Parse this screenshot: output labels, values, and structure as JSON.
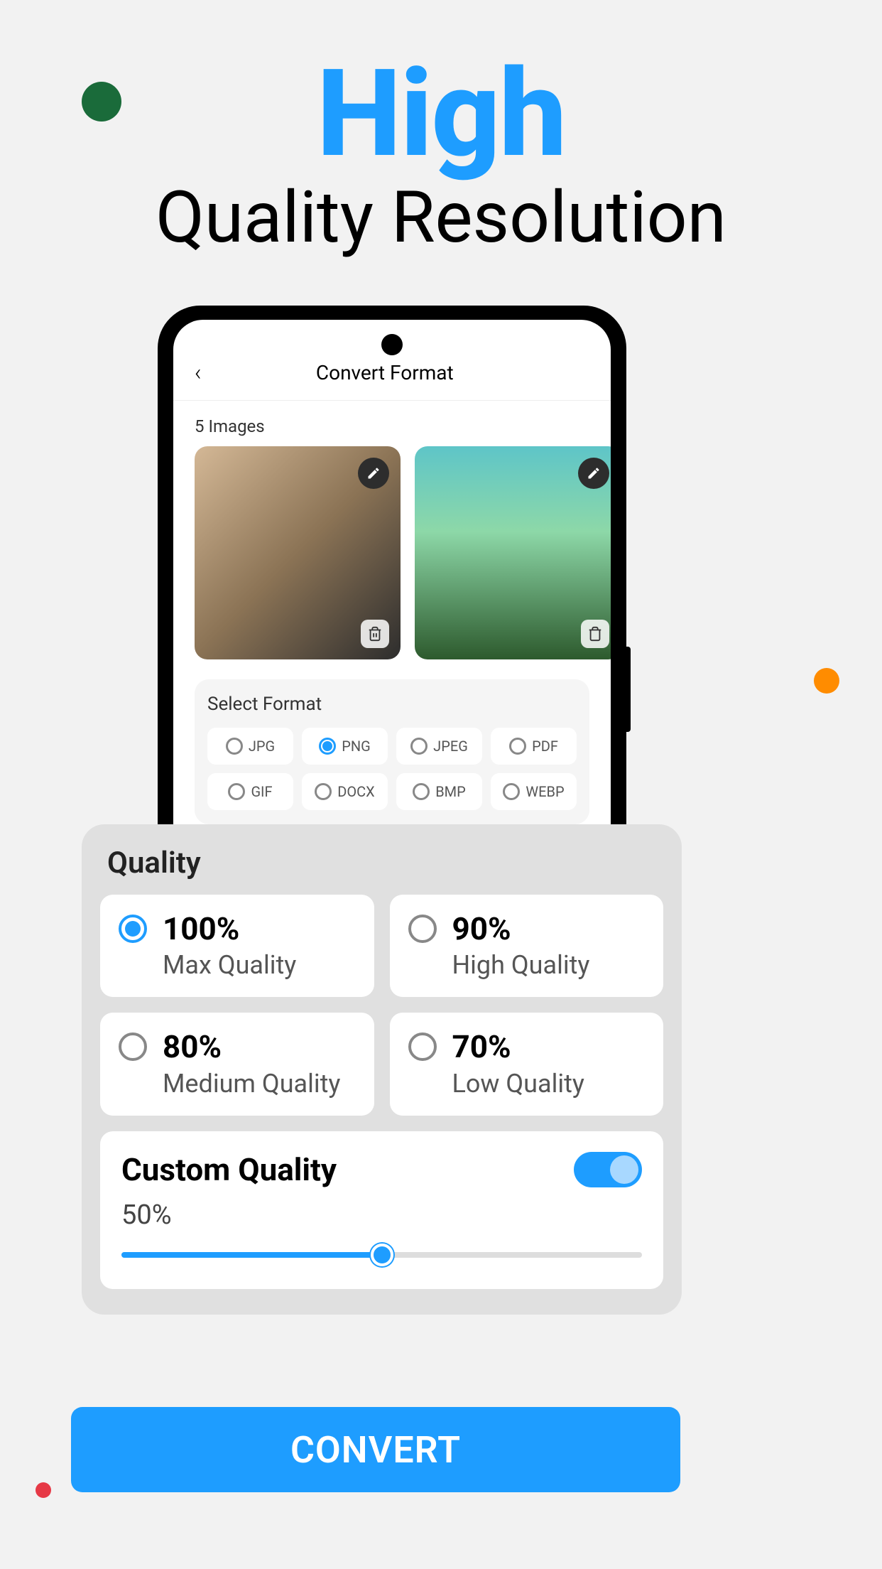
{
  "hero": {
    "high": "High",
    "sub": "Quality Resolution"
  },
  "phone": {
    "title": "Convert Format",
    "images_count": "5 Images",
    "format_title": "Select Format",
    "formats": [
      "JPG",
      "PNG",
      "JPEG",
      "PDF",
      "GIF",
      "DOCX",
      "BMP",
      "WEBP"
    ],
    "selected_format": "PNG"
  },
  "quality": {
    "title": "Quality",
    "options": [
      {
        "percent": "100%",
        "label": "Max Quality",
        "selected": true
      },
      {
        "percent": "90%",
        "label": "High Quality",
        "selected": false
      },
      {
        "percent": "80%",
        "label": "Medium Quality",
        "selected": false
      },
      {
        "percent": "70%",
        "label": "Low Quality",
        "selected": false
      }
    ],
    "custom": {
      "title": "Custom Quality",
      "value": "50%",
      "enabled": true
    }
  },
  "convert_label": "CONVERT"
}
